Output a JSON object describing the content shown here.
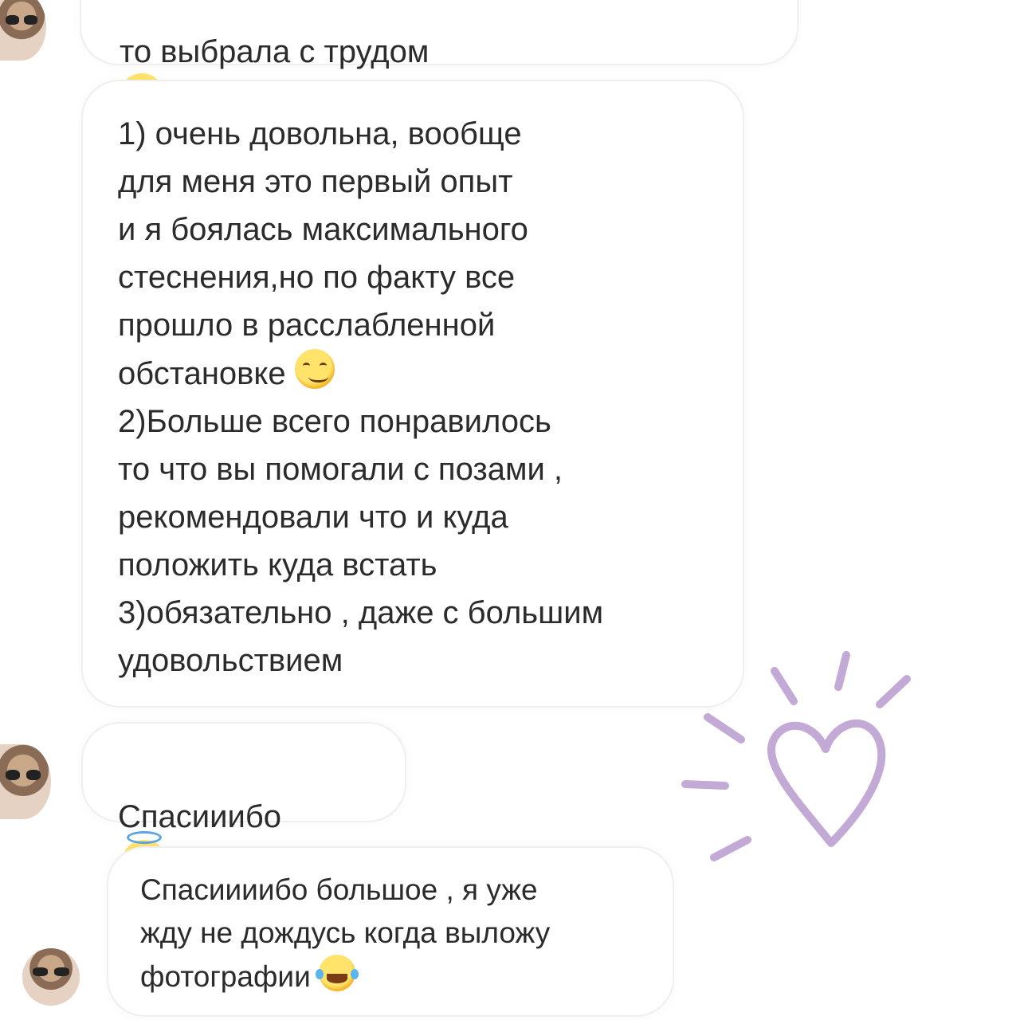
{
  "messages": [
    {
      "text": "то выбрала с трудом",
      "emoji": "smiling-face-icon"
    },
    {
      "text": "1) очень довольна, вообще\nдля меня это первый опыт\nи я боялась максимального\nстеснения,но по факту все\nпрошло в расслабленной\nобстановке",
      "emoji": "smirking-face-icon",
      "text_continued": "2)Больше всего понравилось\nто что вы помогали с позами ,\nрекомендовали что и куда\nположить куда встать\n3)обязательно , даже с большим\nудовольствием"
    },
    {
      "text": "Спасииибо",
      "emoji": "smiling-face-with-halo-icon"
    },
    {
      "text": "Спасиииибо большое , я уже\nжду не дождусь когда выложу\nфотографии",
      "emoji": "tears-of-joy-icon"
    }
  ],
  "decoration": {
    "icon": "heart-doodle-icon",
    "color": "#c3a9d6"
  }
}
